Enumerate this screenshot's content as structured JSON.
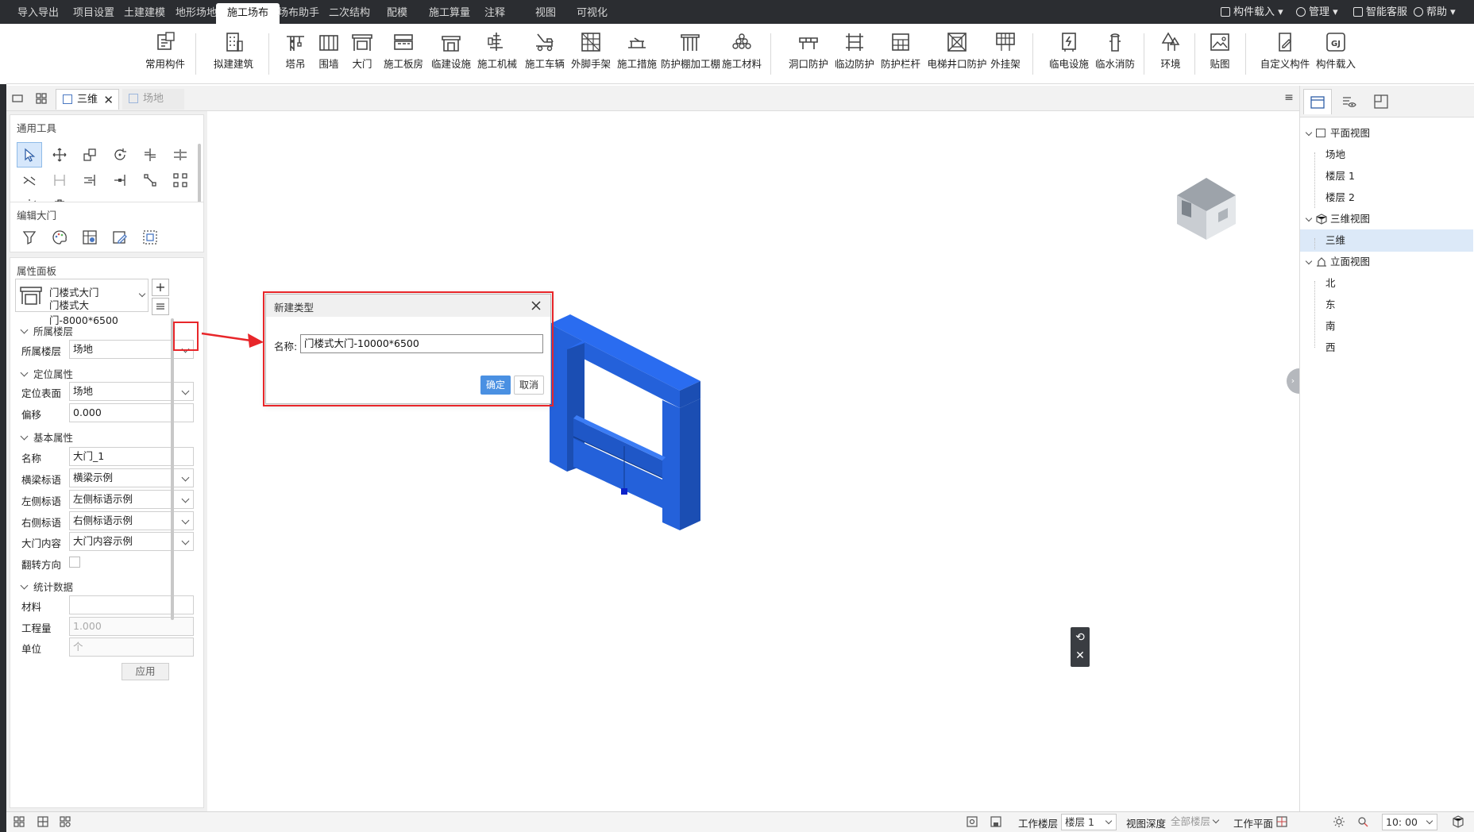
{
  "menu": {
    "tabs": [
      "导入导出",
      "项目设置",
      "土建建模",
      "地形场地",
      "施工场布",
      "场布助手",
      "二次结构",
      "配模",
      "施工算量",
      "注释",
      "视图",
      "可视化"
    ],
    "active_tab": "施工场布",
    "right": [
      "构件载入",
      "管理",
      "智能客服",
      "帮助"
    ]
  },
  "ribbon": {
    "buttons": [
      "常用构件",
      "拟建建筑",
      "塔吊",
      "围墙",
      "大门",
      "施工板房",
      "临建设施",
      "施工机械",
      "施工车辆",
      "外脚手架",
      "施工措施",
      "防护棚加工棚",
      "施工材料",
      "洞口防护",
      "临边防护",
      "防护栏杆",
      "电梯井口防护",
      "外挂架",
      "临电设施",
      "临水消防",
      "环境",
      "贴图",
      "自定义构件",
      "构件载入"
    ]
  },
  "doc_tabs": {
    "active": "三维",
    "inactive": "场地"
  },
  "left_panel": {
    "general_tools_title": "通用工具",
    "edit_gate_title": "编辑大门",
    "props_title": "属性面板",
    "type_name": "门楼式大门",
    "type_sub": "门楼式大门-8000*6500",
    "sections": {
      "floor": "所属楼层",
      "position": "定位属性",
      "basic": "基本属性",
      "stats": "统计数据"
    },
    "fields": {
      "floor_label": "所属楼层",
      "floor_value": "场地",
      "surface_label": "定位表面",
      "surface_value": "场地",
      "offset_label": "偏移",
      "offset_value": "0.000",
      "name_label": "名称",
      "name_value": "大门_1",
      "beam_label": "横梁标语",
      "beam_value": "横梁示例",
      "left_label": "左侧标语",
      "left_value": "左侧标语示例",
      "right_label": "右侧标语",
      "right_value": "右侧标语示例",
      "content_label": "大门内容",
      "content_value": "大门内容示例",
      "flip_label": "翻转方向",
      "material_label": "材料",
      "material_value": "",
      "qty_label": "工程量",
      "qty_value": "1.000",
      "unit_label": "单位",
      "unit_value": "个"
    },
    "apply_label": "应用"
  },
  "dialog": {
    "title": "新建类型",
    "name_label": "名称:",
    "name_value": "门楼式大门-10000*6500",
    "ok": "确定",
    "cancel": "取消"
  },
  "right_panel": {
    "tree": [
      {
        "label": "平面视图",
        "level": 0,
        "expanded": true
      },
      {
        "label": "场地",
        "level": 1
      },
      {
        "label": "楼层 1",
        "level": 1
      },
      {
        "label": "楼层 2",
        "level": 1
      },
      {
        "label": "三维视图",
        "level": 0,
        "expanded": true
      },
      {
        "label": "三维",
        "level": 1,
        "selected": true
      },
      {
        "label": "立面视图",
        "level": 0,
        "expanded": true
      },
      {
        "label": "北",
        "level": 1
      },
      {
        "label": "东",
        "level": 1
      },
      {
        "label": "南",
        "level": 1
      },
      {
        "label": "西",
        "level": 1
      }
    ]
  },
  "status": {
    "work_floor_label": "工作楼层",
    "work_floor_value": "楼层 1",
    "view_depth_label": "视图深度",
    "view_depth_value": "全部楼层",
    "work_plane_label": "工作平面",
    "time_value": "10: 00"
  },
  "colors": {
    "gate_blue": "#2563d9",
    "highlight_red": "#e8262a",
    "accent": "#4a90e2"
  }
}
